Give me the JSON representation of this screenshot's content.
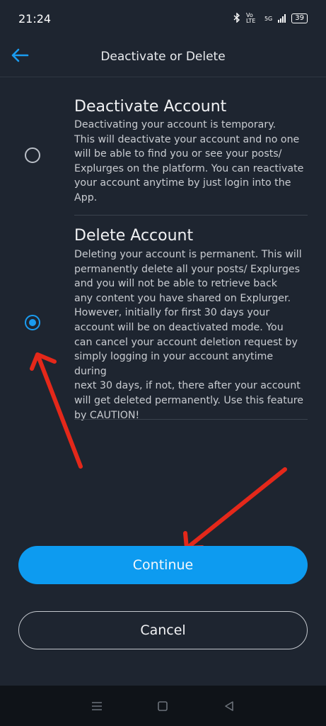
{
  "status_bar": {
    "time": "21:24",
    "battery": "39",
    "network": "5G",
    "volte": "Vo LTE"
  },
  "header": {
    "title": "Deactivate or Delete"
  },
  "options": [
    {
      "title": "Deactivate Account",
      "lines": [
        "Deactivating your account is temporary.",
        "This will deactivate your account and no one",
        "will be able to find you or see your posts/",
        "Explurges on the platform. You can reactivate",
        "your account anytime by just login into the",
        "App."
      ],
      "selected": false
    },
    {
      "title": "Delete Account",
      "lines": [
        "Deleting your account is permanent. This will",
        "permanently delete all your posts/ Explurges",
        "and you will not be able to retrieve back",
        "any content you have shared on Explurger.",
        "However, initially for first 30 days your",
        "account will be on deactivated mode. You",
        "can cancel your account deletion request by",
        "simply logging in your account anytime during",
        "next 30 days, if not, there after your account",
        "will get deleted permanently. Use this feature",
        "by CAUTION!"
      ],
      "selected": true
    }
  ],
  "buttons": {
    "continue": "Continue",
    "cancel": "Cancel"
  },
  "colors": {
    "background": "#1e2530",
    "accent": "#0d9bf0",
    "annotation_arrow": "#e4281a"
  },
  "icons": {
    "back": "arrow-left-icon",
    "nav": [
      "menu-icon",
      "home-square-icon",
      "back-triangle-icon"
    ]
  }
}
